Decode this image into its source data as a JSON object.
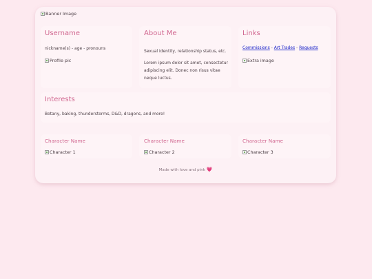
{
  "banner_alt": "Banner Image",
  "username": {
    "title": "Username",
    "subtitle": "nickname(s) - age - pronouns",
    "pic_alt": "Profile pic"
  },
  "about": {
    "title": "About Me",
    "identity": "Sexual identity, relationship status, etc.",
    "lines": [
      "Lorem ipsum dolor sit amet, consectetur",
      "adipiscing elit. Donec non risus vitae",
      "neque luctus."
    ]
  },
  "links": {
    "title": "Links",
    "items": [
      "Commissions",
      "Art Trades",
      "Requests"
    ],
    "separator": " - ",
    "extra_alt": "Extra image"
  },
  "interests": {
    "title": "Interests",
    "text": "Botany, baking, thunderstorms, D&D, dragons, and more!"
  },
  "characters": [
    {
      "name": "Character Name",
      "img_alt": "Character 1"
    },
    {
      "name": "Character Name",
      "img_alt": "Character 2"
    },
    {
      "name": "Character Name",
      "img_alt": "Character 3"
    }
  ],
  "footer": {
    "text": "Made with love and pink",
    "heart": "💗"
  },
  "colors": {
    "background": "#fde9ef",
    "card": "#fdf1f5",
    "accent": "#d0668f",
    "link": "#1a24c9"
  }
}
